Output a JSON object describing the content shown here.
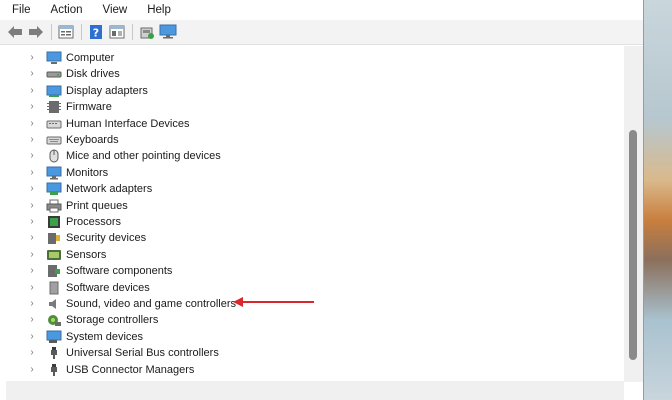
{
  "menu": [
    "File",
    "Action",
    "View",
    "Help"
  ],
  "toolbar": [
    "back-icon",
    "forward-icon",
    "properties-icon",
    "help-icon",
    "show-hide-icon",
    "scan-hardware-icon",
    "monitor-icon"
  ],
  "devices": [
    {
      "label": "Computer",
      "icon": "computer-icon"
    },
    {
      "label": "Disk drives",
      "icon": "disk-drive-icon"
    },
    {
      "label": "Display adapters",
      "icon": "display-adapter-icon"
    },
    {
      "label": "Firmware",
      "icon": "firmware-icon"
    },
    {
      "label": "Human Interface Devices",
      "icon": "hid-icon"
    },
    {
      "label": "Keyboards",
      "icon": "keyboard-icon"
    },
    {
      "label": "Mice and other pointing devices",
      "icon": "mouse-icon"
    },
    {
      "label": "Monitors",
      "icon": "monitor-icon"
    },
    {
      "label": "Network adapters",
      "icon": "network-adapter-icon"
    },
    {
      "label": "Print queues",
      "icon": "printer-icon"
    },
    {
      "label": "Processors",
      "icon": "processor-icon"
    },
    {
      "label": "Security devices",
      "icon": "security-device-icon"
    },
    {
      "label": "Sensors",
      "icon": "sensor-icon"
    },
    {
      "label": "Software components",
      "icon": "software-component-icon"
    },
    {
      "label": "Software devices",
      "icon": "software-device-icon"
    },
    {
      "label": "Sound, video and game controllers",
      "icon": "speaker-icon"
    },
    {
      "label": "Storage controllers",
      "icon": "storage-controller-icon"
    },
    {
      "label": "System devices",
      "icon": "system-device-icon"
    },
    {
      "label": "Universal Serial Bus controllers",
      "icon": "usb-icon"
    },
    {
      "label": "USB Connector Managers",
      "icon": "usb-icon"
    }
  ],
  "annotation": {
    "target": "Sound, video and game controllers",
    "color": "#d9272e"
  },
  "colors": {
    "icon_blue": "#2b7fd6",
    "icon_gray": "#5a5a5a"
  }
}
